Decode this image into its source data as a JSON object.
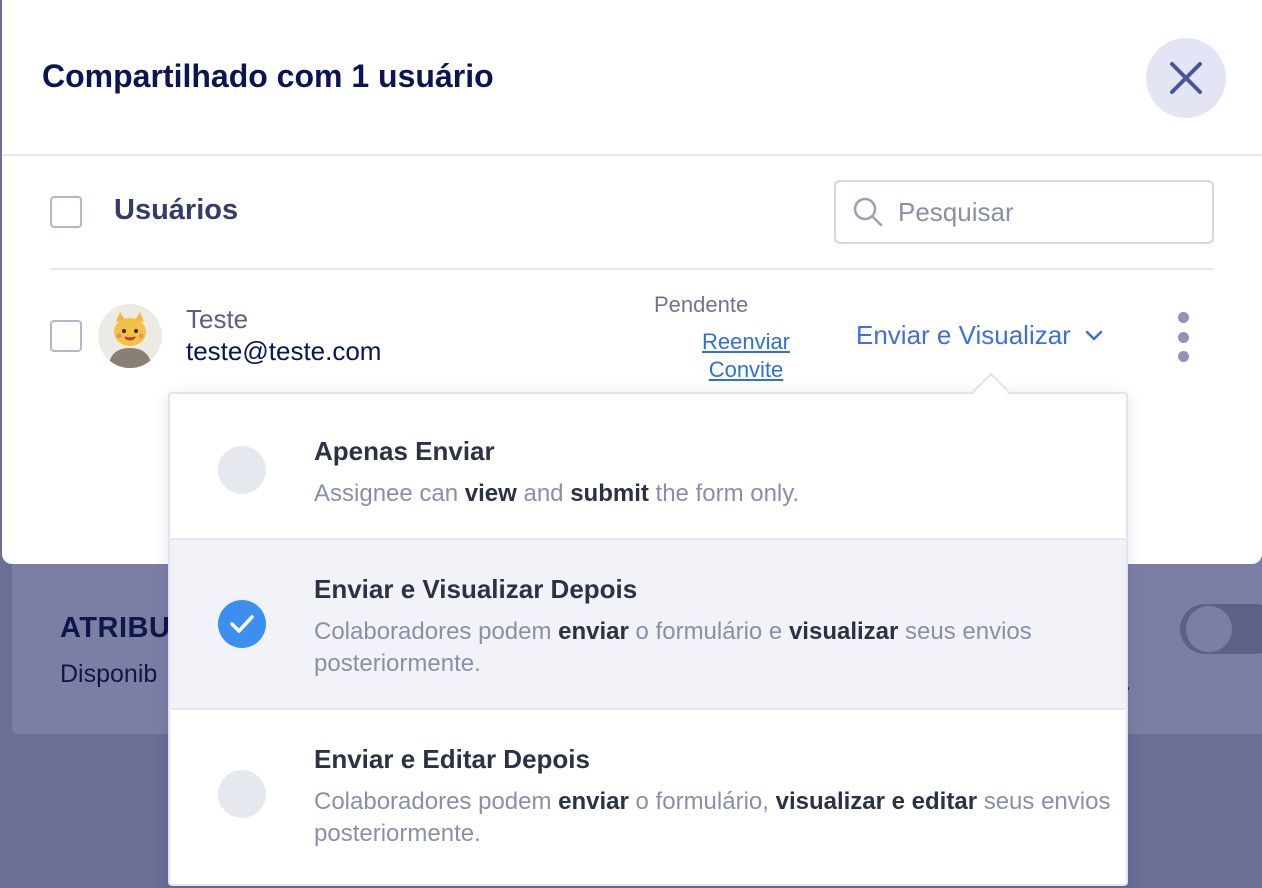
{
  "background": {
    "section_title": "ATRIBU",
    "section_subtitle": "Disponib",
    "trailing_dot": "."
  },
  "modal": {
    "title": "Compartilhado com 1 usuário",
    "close_icon": "close-icon"
  },
  "users_header": {
    "label": "Usuários",
    "search_placeholder": "Pesquisar"
  },
  "user_row": {
    "name": "Teste",
    "email": "teste@teste.com",
    "status": "Pendente",
    "resend_line1": "Reenviar",
    "resend_line2": "Convite",
    "permission": "Enviar e Visualizar"
  },
  "permission_options": [
    {
      "title": "Apenas Enviar",
      "desc_parts": [
        "Assignee can ",
        "view",
        " and ",
        "submit",
        " the form only."
      ],
      "selected": false
    },
    {
      "title": "Enviar e Visualizar Depois",
      "desc_parts": [
        "Colaboradores podem ",
        "enviar",
        " o formulário e ",
        "visualizar",
        " seus envios posteriormente."
      ],
      "selected": true
    },
    {
      "title": "Enviar e Editar Depois",
      "desc_parts": [
        "Colaboradores podem ",
        "enviar",
        " o formulário, ",
        "visualizar e editar",
        " seus envios posteriormente."
      ],
      "selected": false
    }
  ],
  "colors": {
    "accent": "#3d8fef",
    "link": "#2f6fe0",
    "title": "#0a1551",
    "overlay": "#6b6e95"
  }
}
